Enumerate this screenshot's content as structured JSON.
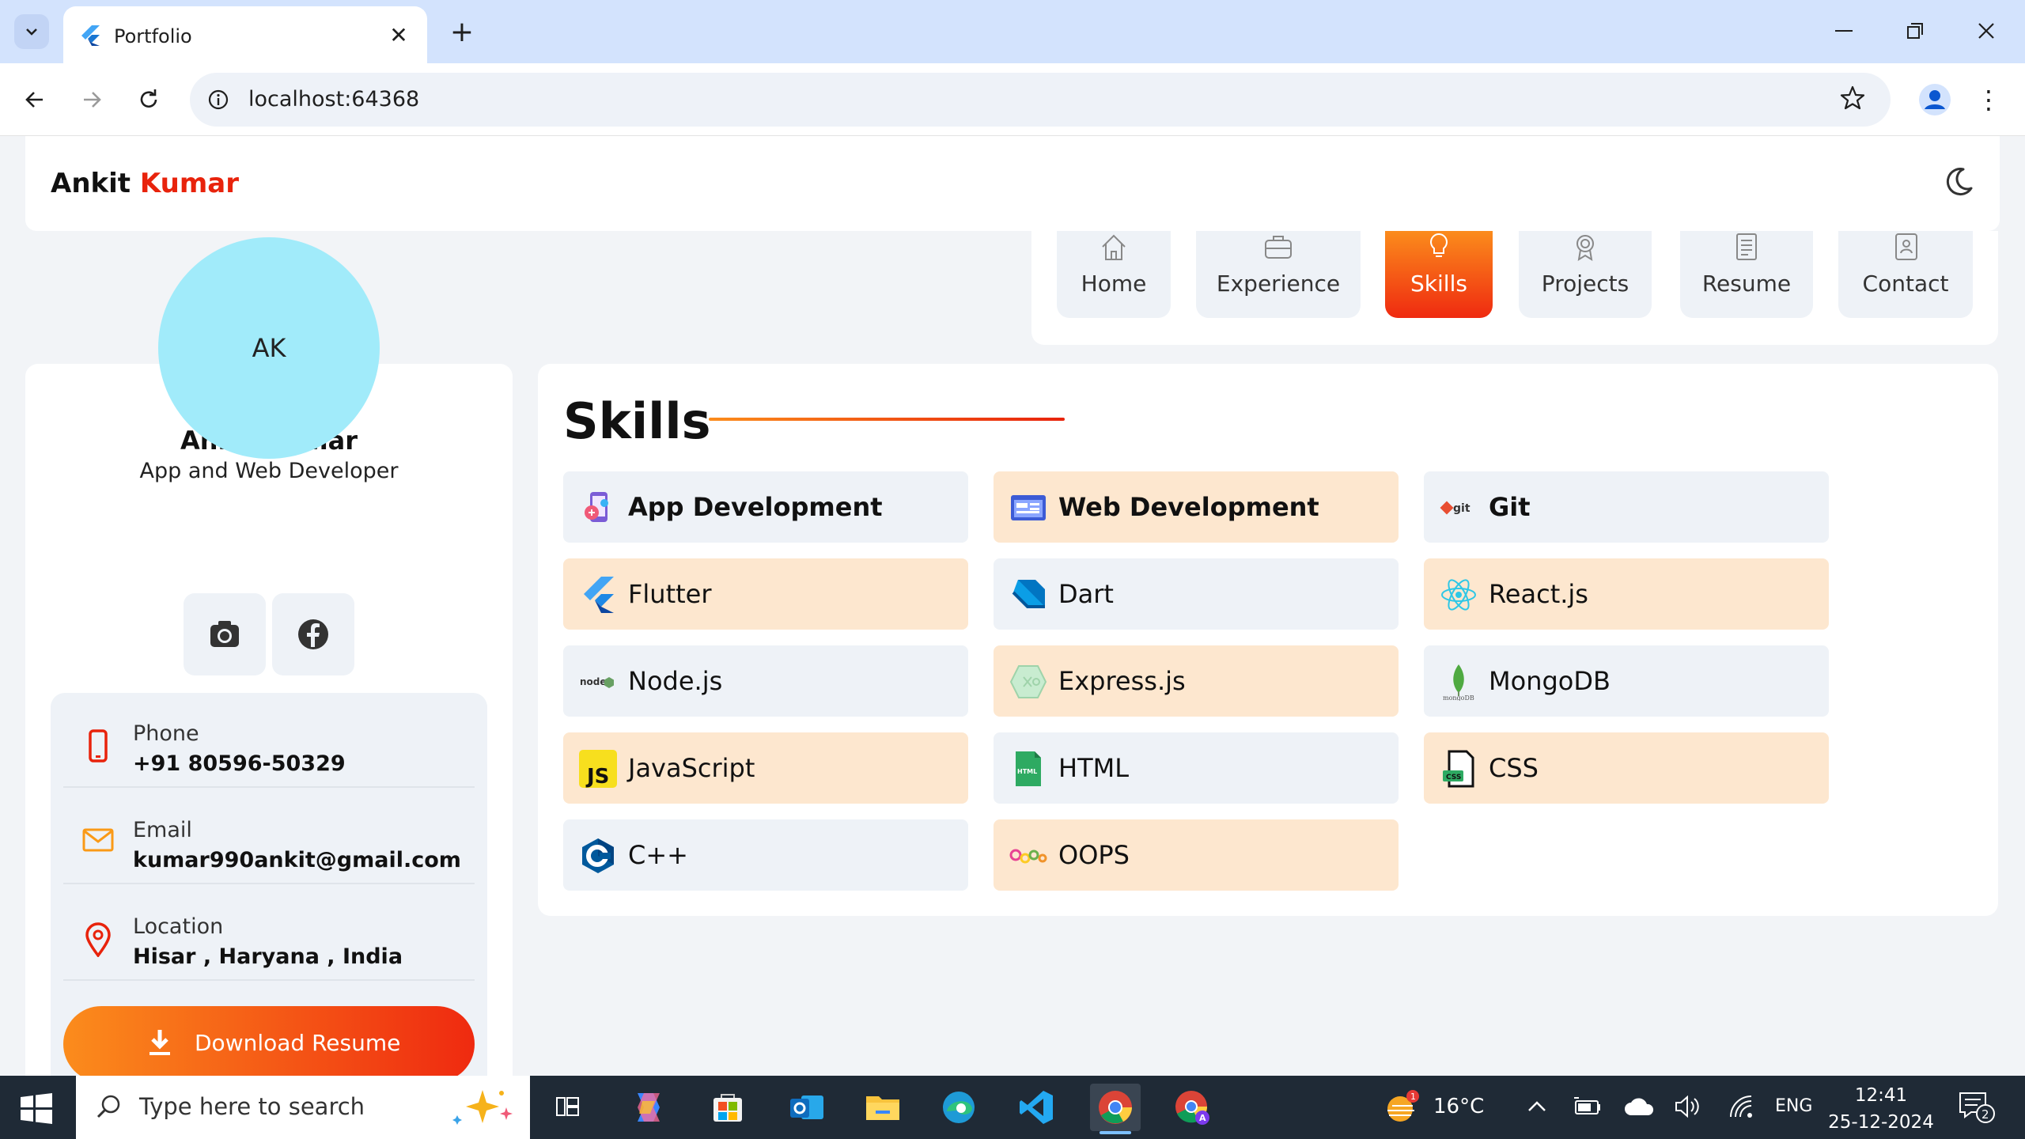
{
  "browser": {
    "tab_title": "Portfolio",
    "url": "localhost:64368"
  },
  "header": {
    "brand_first": "Ankit ",
    "brand_last": "Kumar"
  },
  "nav": {
    "items": [
      {
        "label": "Home",
        "icon": "home-icon"
      },
      {
        "label": "Experience",
        "icon": "briefcase-icon"
      },
      {
        "label": "Skills",
        "icon": "lightbulb-icon",
        "active": true
      },
      {
        "label": "Projects",
        "icon": "award-icon"
      },
      {
        "label": "Resume",
        "icon": "document-icon"
      },
      {
        "label": "Contact",
        "icon": "contact-book-icon"
      }
    ]
  },
  "profile": {
    "initials": "AK",
    "name": "Ankit Kumar",
    "role": "App and Web Developer",
    "socials": [
      "instagram-icon",
      "facebook-icon"
    ],
    "contacts": [
      {
        "label": "Phone",
        "value": "+91 80596-50329",
        "icon": "phone-icon"
      },
      {
        "label": "Email",
        "value": "kumar990ankit@gmail.com",
        "icon": "mail-icon"
      },
      {
        "label": "Location",
        "value": "Hisar , Haryana , India",
        "icon": "location-pin-icon"
      }
    ],
    "download_label": "Download Resume"
  },
  "skills": {
    "title": "Skills",
    "items": [
      {
        "label": "App Development",
        "style": "blue",
        "head": true
      },
      {
        "label": "Web Development",
        "style": "peach",
        "head": true
      },
      {
        "label": "Git",
        "style": "blue",
        "head": true
      },
      {
        "label": "Flutter",
        "style": "peach"
      },
      {
        "label": "Dart",
        "style": "blue"
      },
      {
        "label": "React.js",
        "style": "peach"
      },
      {
        "label": "Node.js",
        "style": "blue"
      },
      {
        "label": "Express.js",
        "style": "peach"
      },
      {
        "label": "MongoDB",
        "style": "blue"
      },
      {
        "label": "JavaScript",
        "style": "peach"
      },
      {
        "label": "HTML",
        "style": "blue"
      },
      {
        "label": "CSS",
        "style": "peach"
      },
      {
        "label": "C++",
        "style": "blue"
      },
      {
        "label": "OOPS",
        "style": "peach"
      }
    ],
    "icon_text": {
      "git": "git",
      "node": "node",
      "js": "JS",
      "html": "HTML",
      "css": "CSS",
      "mongodb": "mongoDB"
    }
  },
  "taskbar": {
    "search_placeholder": "Type here to search",
    "weather": "16°C",
    "weather_badge": "1",
    "language": "ENG",
    "time": "12:41",
    "date": "25-12-2024",
    "notification_count": "2"
  }
}
